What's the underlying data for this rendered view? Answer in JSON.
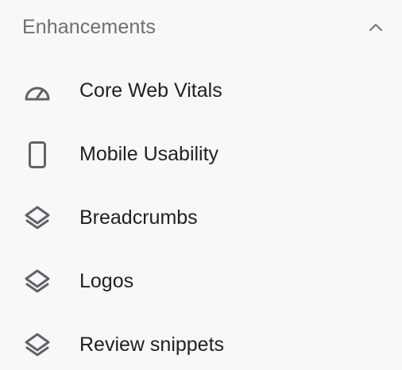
{
  "section": {
    "title": "Enhancements",
    "expanded": true,
    "toggle_icon": "chevron-up-icon"
  },
  "items": [
    {
      "label": "Core Web Vitals",
      "icon": "speedometer-icon"
    },
    {
      "label": "Mobile Usability",
      "icon": "smartphone-icon"
    },
    {
      "label": "Breadcrumbs",
      "icon": "layers-icon"
    },
    {
      "label": "Logos",
      "icon": "layers-icon"
    },
    {
      "label": "Review snippets",
      "icon": "layers-icon"
    }
  ],
  "colors": {
    "background": "#f8f8f8",
    "header_text": "#6f6f6f",
    "item_text": "#212121",
    "icon": "#5f6368"
  }
}
